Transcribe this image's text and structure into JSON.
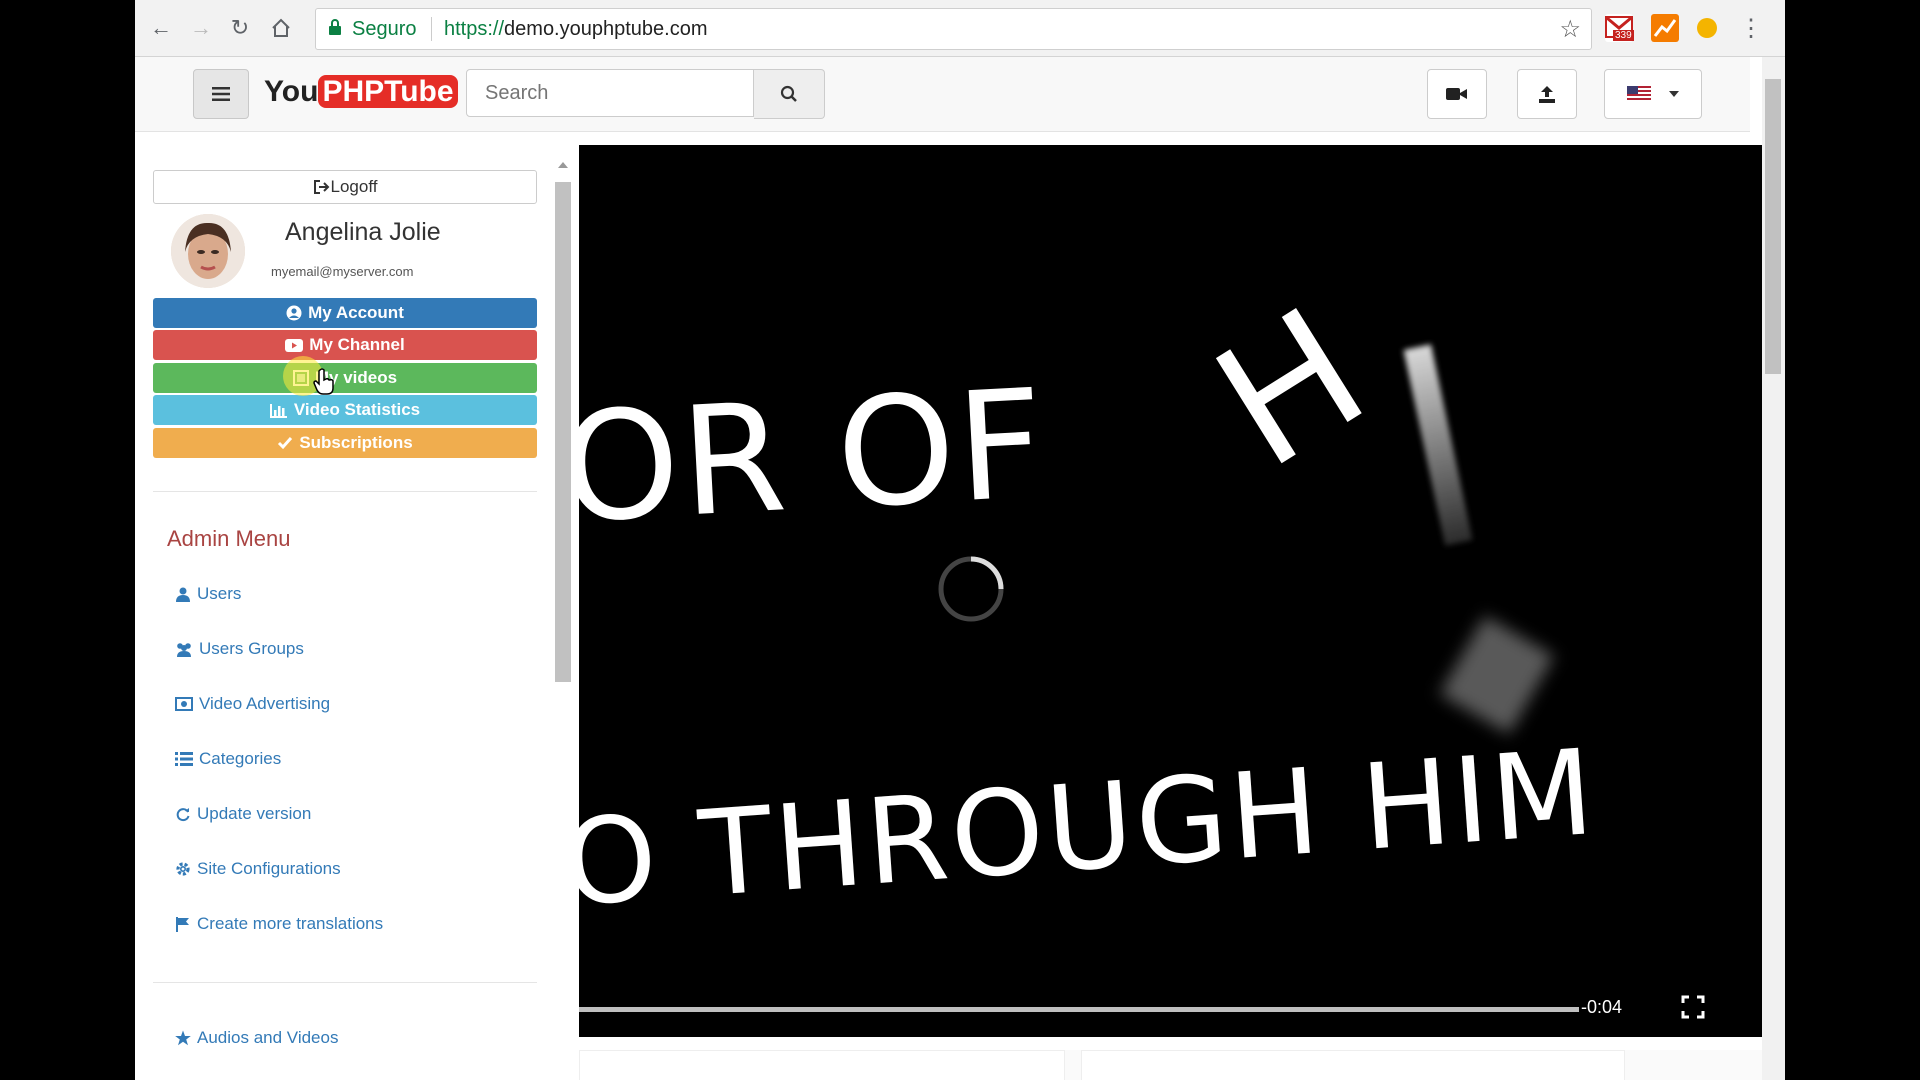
{
  "browser": {
    "secure_label": "Seguro",
    "url_scheme": "https://",
    "url_host": "demo.youphptube.com",
    "gmail_badge": "339"
  },
  "header": {
    "logo_you": "You",
    "logo_php": "PHPTube",
    "search_placeholder": "Search"
  },
  "sidebar": {
    "logoff_label": "Logoff",
    "user_name": "Angelina Jolie",
    "user_email": "myemail@myserver.com",
    "buttons": [
      {
        "label": "My Account",
        "color": "#337ab7"
      },
      {
        "label": "My Channel",
        "color": "#d9534f"
      },
      {
        "label": "My videos",
        "color": "#5cb85c"
      },
      {
        "label": "Video Statistics",
        "color": "#5bc0de"
      },
      {
        "label": "Subscriptions",
        "color": "#f0ad4e"
      }
    ],
    "admin_title": "Admin Menu",
    "admin_items": [
      {
        "label": "Users"
      },
      {
        "label": "Users Groups"
      },
      {
        "label": "Video Advertising"
      },
      {
        "label": "Categories"
      },
      {
        "label": "Update version"
      },
      {
        "label": "Site Configurations"
      },
      {
        "label": "Create more translations"
      }
    ],
    "bottom_item": "Audios and Videos"
  },
  "video": {
    "line1": "OR OF",
    "letter": "H",
    "line2": "O THROUGH HIM",
    "time_remaining": "-0:04"
  },
  "colors": {
    "accent": "#337ab7",
    "admin_heading": "#a94442",
    "logo_red": "#e52d27"
  }
}
